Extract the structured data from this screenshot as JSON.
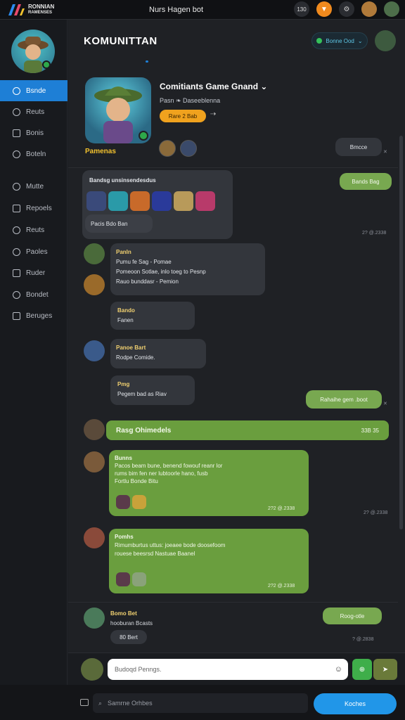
{
  "app": {
    "logo_line1": "RONNIAN",
    "logo_line2": "RAMENSES",
    "window_title": "Nurs Hagen bot"
  },
  "topbar": {
    "badge": "130"
  },
  "sidebar": {
    "items": [
      {
        "label": "Bsnde",
        "active": true
      },
      {
        "label": "Reuts"
      },
      {
        "label": "Bonis"
      },
      {
        "label": "Boteln"
      },
      {
        "label": "Mutte"
      },
      {
        "label": "Repoels"
      },
      {
        "label": "Reuts"
      },
      {
        "label": "Paoles"
      },
      {
        "label": "Ruder"
      },
      {
        "label": "Bondet"
      },
      {
        "label": "Beruges"
      }
    ]
  },
  "header": {
    "title": "KOMUNITTAN",
    "status_pill": "Bonne Ood"
  },
  "group": {
    "name": "Comitiants Game Gnand",
    "subtitle": "Pasn ❧ Daseeblenna",
    "join_button": "Rare 2 Bab",
    "caption": "Pamenas",
    "side_chip": "Bmcce"
  },
  "messages": {
    "m1_title": "Bandsg unsinsendesdus",
    "m1_footer": "Pacis Bdo Ban",
    "m1_chip": "Bands Bag",
    "m1_ts": "2? @.2338",
    "m2_name": "Panln",
    "m2_line1": "Pumu fe Sag - Pomae",
    "m2_line2": "Pomeoon Sotlae, inlo toeg to Pesnp",
    "m2_line3": "Rauo bunddasr - Pemion",
    "m3_name": "Bando",
    "m3_line": "Fanen",
    "m4_name": "Panoe Bart",
    "m4_line": "Rodpe Comide.",
    "m5_name": "Pmg",
    "m5_line": "Pegem bad as Riav",
    "m5_chip": "Rahaihe gem .boot",
    "banner": "Rasg Ohimedels",
    "banner_ts": "33B 35",
    "m6_name": "Bunns",
    "m6_line1": "Pacos beam bune, benend fowouf reanr lor",
    "m6_line2": "rums bim fen ner lubtoorle hano, fusb",
    "m6_line3": "Fortlu Bonde Bitu",
    "m6_ts": "2?2 @.2338",
    "m6_side_ts": "2? @.2338",
    "m7_name": "Pomhs",
    "m7_line1": "Rimumburtus uttus: joeaee bode doosefoom",
    "m7_line2": "rouese beesrsd Nastuae Baanel",
    "m7_ts": "2?2 @.2338",
    "m8_name": "Bomo Bet",
    "m8_line": "hooburan Bcasts",
    "m8_sub": "80 Bert",
    "m8_chip": "Roog-otle",
    "m8_ts": "? @.2838"
  },
  "composer": {
    "placeholder": "Budoqd Penngs."
  },
  "bottom": {
    "search_label": "Samrne Orhbes",
    "cta": "Koches"
  },
  "colors": {
    "accent": "#1e7fd6",
    "green": "#6a9e3e",
    "gold": "#f0a21e"
  }
}
